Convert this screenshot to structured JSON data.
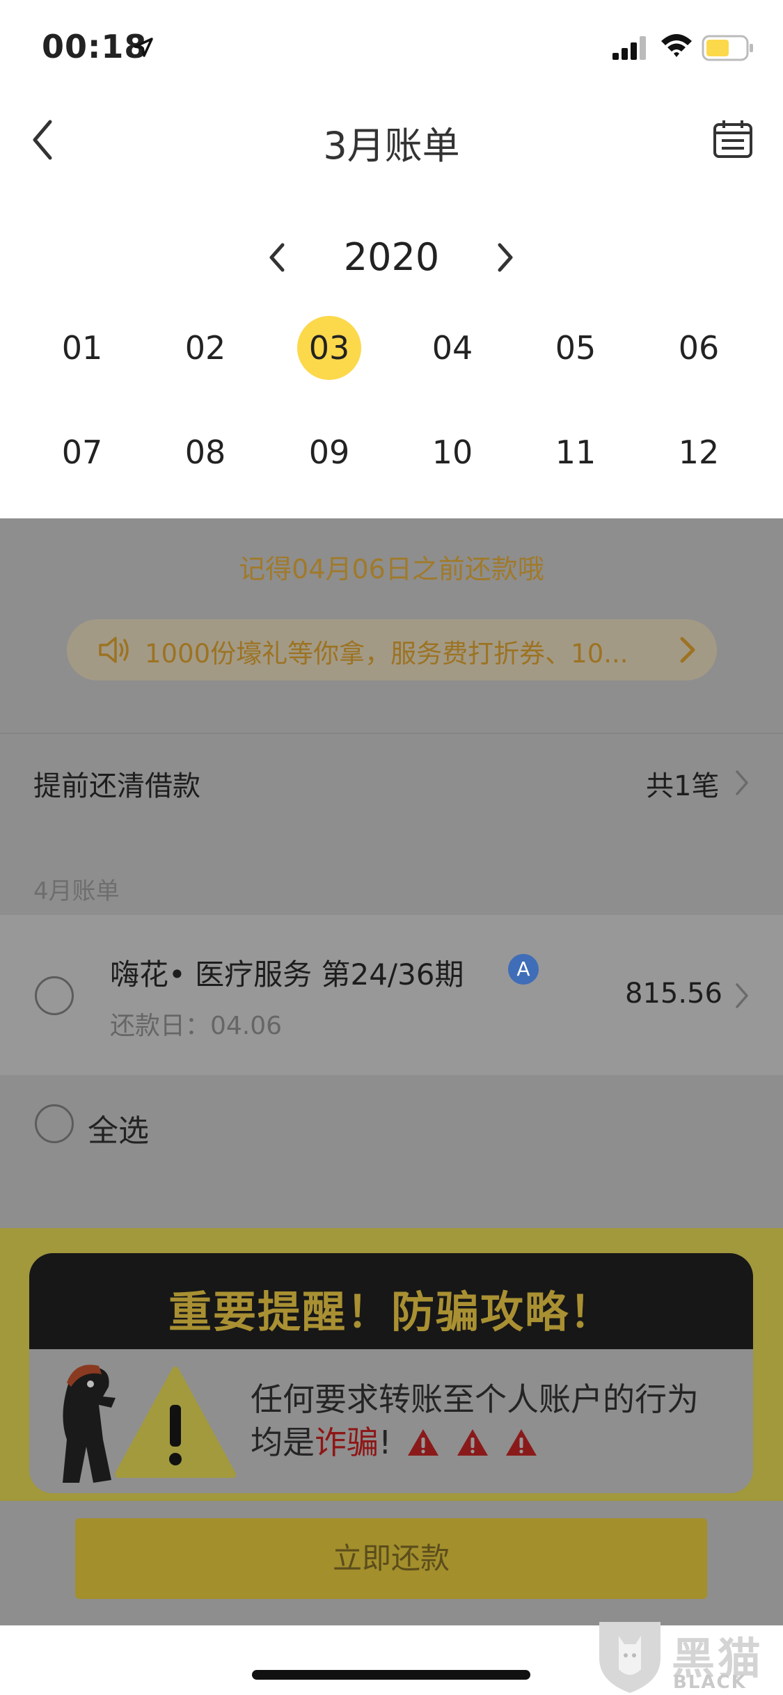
{
  "status_bar": {
    "time": "00:18",
    "battery_color": "#fcd84b"
  },
  "nav": {
    "title": "3月账单",
    "back_icon": "chevron-left-icon",
    "calendar_icon": "calendar-icon"
  },
  "year_picker": {
    "year": "2020"
  },
  "months": {
    "row1": [
      "01",
      "02",
      "03",
      "04",
      "05",
      "06"
    ],
    "row2": [
      "07",
      "08",
      "09",
      "10",
      "11",
      "12"
    ],
    "selected": "03"
  },
  "reminder": "记得04月06日之前还款哦",
  "promo": {
    "text": "1000份壕礼等你拿，服务费打折券、10..."
  },
  "payoff": {
    "label": "提前还清借款",
    "count": "共1笔"
  },
  "section_label": "4月账单",
  "bill": {
    "title": "嗨花• 医疗服务 第24/36期",
    "badge": "A",
    "date": "还款日：04.06",
    "amount": "815.56"
  },
  "select_all": {
    "label": "全选"
  },
  "fraud_banner": {
    "title": "重要提醒！防骗攻略！",
    "line1": "任何要求转账至个人账户的行为",
    "line2_prefix": "均是",
    "line2_red": "诈骗",
    "line2_suffix": "!"
  },
  "pay_button": {
    "label": "立即还款"
  },
  "watermark": {
    "cn": "黑猫",
    "en": "BLACK CAT"
  },
  "colors": {
    "accent_yellow": "#fcd84b",
    "overlay_grey": "#8e8e8e",
    "fraud_red": "#8e1616"
  }
}
